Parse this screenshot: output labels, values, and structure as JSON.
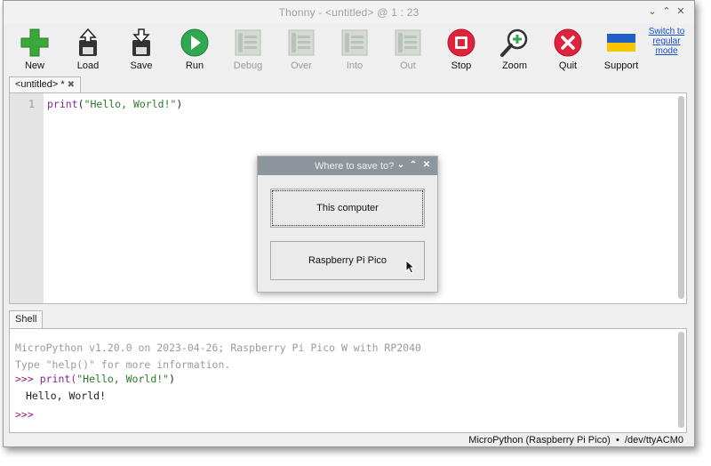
{
  "window": {
    "title": "Thonny  -  <untitled>  @  1 : 23"
  },
  "toolbar": {
    "buttons": [
      {
        "label": "New",
        "icon": "plus-icon",
        "enabled": true
      },
      {
        "label": "Load",
        "icon": "load-icon",
        "enabled": true
      },
      {
        "label": "Save",
        "icon": "save-icon",
        "enabled": true
      },
      {
        "label": "Run",
        "icon": "run-icon",
        "enabled": true
      },
      {
        "label": "Debug",
        "icon": "debug-icon",
        "enabled": false
      },
      {
        "label": "Over",
        "icon": "step-over-icon",
        "enabled": false
      },
      {
        "label": "Into",
        "icon": "step-into-icon",
        "enabled": false
      },
      {
        "label": "Out",
        "icon": "step-out-icon",
        "enabled": false
      },
      {
        "label": "Stop",
        "icon": "stop-icon",
        "enabled": true
      },
      {
        "label": "Zoom",
        "icon": "zoom-icon",
        "enabled": true
      },
      {
        "label": "Quit",
        "icon": "quit-icon",
        "enabled": true
      },
      {
        "label": "Support",
        "icon": "ukraine-flag-icon",
        "enabled": true
      }
    ],
    "switch_mode_link": "Switch to regular mode"
  },
  "editor": {
    "tab_label": "<untitled> *",
    "tab_close": "✖",
    "line_numbers": [
      "1"
    ],
    "code": {
      "func": "print",
      "open": "(",
      "string": "\"Hello, World!\"",
      "close": ")"
    }
  },
  "shell": {
    "tab_label": "Shell",
    "banner_line1": "MicroPython v1.20.0 on 2023-04-26; Raspberry Pi Pico W with RP2040",
    "banner_line2": "Type \"help()\" for more information.",
    "prompt": ">>>",
    "command_func": " print(",
    "command_string": "\"Hello, World!\"",
    "command_close": ")",
    "output": "Hello, World!"
  },
  "statusbar": {
    "interpreter": "MicroPython (Raspberry Pi Pico)",
    "separator": "•",
    "port": "/dev/ttyACM0"
  },
  "dialog": {
    "title": "Where to save to?",
    "option_this_computer": "This computer",
    "option_pico": "Raspberry Pi Pico"
  },
  "colors": {
    "new_green": "#3aa83a",
    "run_green": "#2fa84f",
    "stop_red": "#e0233a",
    "quit_red": "#e0233a",
    "dialog_title_bg": "#8d969b",
    "prompt_purple": "#9a1a78",
    "string_green": "#2b7a2b"
  }
}
